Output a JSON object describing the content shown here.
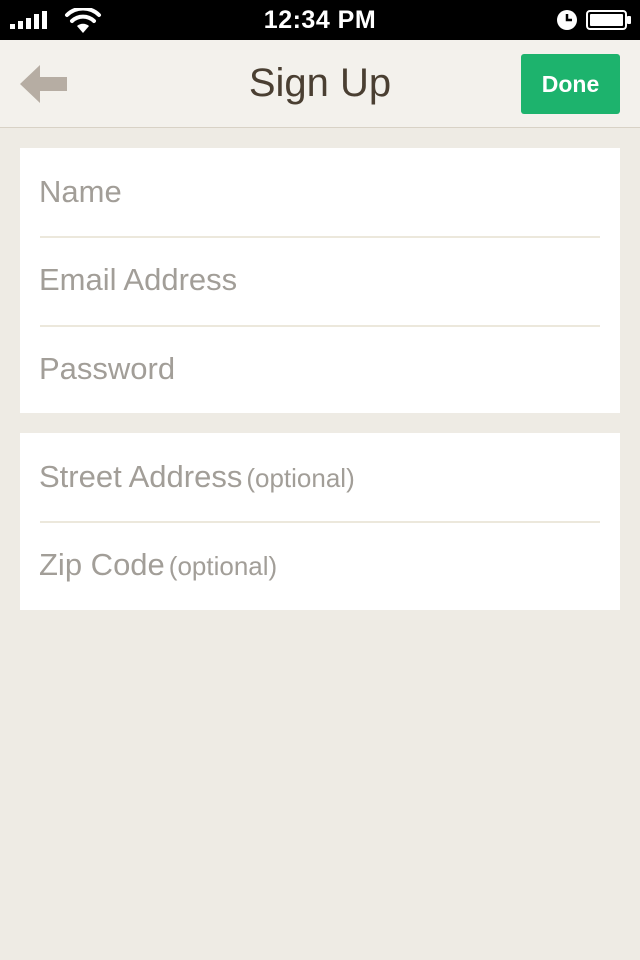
{
  "status_bar": {
    "time": "12:34 PM"
  },
  "nav": {
    "title": "Sign Up",
    "done_label": "Done",
    "accent_color": "#1db36d"
  },
  "form": {
    "required_fields": [
      {
        "placeholder": "Name"
      },
      {
        "placeholder": "Email Address"
      },
      {
        "placeholder": "Password"
      }
    ],
    "optional_fields": [
      {
        "placeholder": "Street Address",
        "hint": "(optional)"
      },
      {
        "placeholder": "Zip Code",
        "hint": "(optional)"
      }
    ]
  },
  "icons": {
    "back": "arrow-left-icon",
    "signal": "cellular-signal-icon",
    "wifi": "wifi-icon",
    "alarm": "alarm-clock-icon",
    "battery": "battery-icon"
  }
}
